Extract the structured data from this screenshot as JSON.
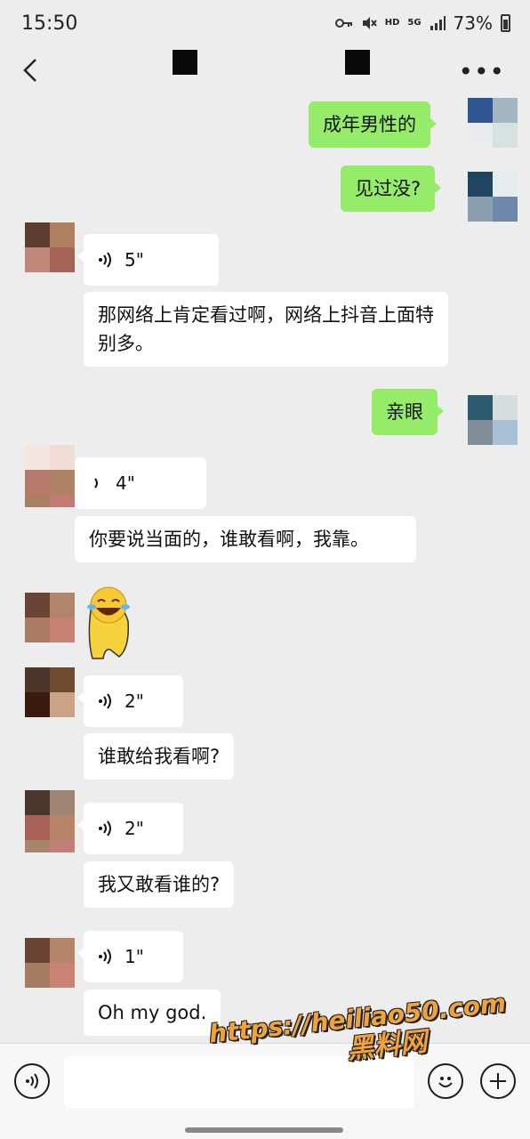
{
  "status_bar": {
    "time": "15:50",
    "hd_label": "HD",
    "network_label": "5G",
    "battery_percent": "73%"
  },
  "header": {
    "back_icon": "chevron-left-icon",
    "more_icon": "more-dots-icon",
    "more_label": "•••"
  },
  "messages": [
    {
      "side": "out",
      "type": "text",
      "text": "成年男性的"
    },
    {
      "side": "out",
      "type": "text",
      "text": "见过没?"
    },
    {
      "side": "in",
      "type": "voice",
      "duration": "5\""
    },
    {
      "side": "in",
      "type": "text",
      "text": "那网络上肯定看过啊，网络上抖音上面特别多。"
    },
    {
      "side": "out",
      "type": "text",
      "text": "亲眼"
    },
    {
      "side": "in",
      "type": "voice",
      "duration": "4\""
    },
    {
      "side": "in",
      "type": "text",
      "text": "你要说当面的，谁敢看啊，我靠。"
    },
    {
      "side": "in",
      "type": "sticker",
      "icon": "laughing-emoji-sticker"
    },
    {
      "side": "in",
      "type": "voice",
      "duration": "2\""
    },
    {
      "side": "in",
      "type": "text",
      "text": "谁敢给我看啊?"
    },
    {
      "side": "in",
      "type": "voice",
      "duration": "2\""
    },
    {
      "side": "in",
      "type": "text",
      "text": "我又敢看谁的?"
    },
    {
      "side": "in",
      "type": "voice",
      "duration": "1\""
    },
    {
      "side": "in",
      "type": "text",
      "text": "Oh my god."
    }
  ],
  "input_bar": {
    "voice_toggle_icon": "voice-wave-icon",
    "emoji_icon": "smiley-icon",
    "plus_icon": "plus-icon"
  },
  "watermark": {
    "url": "https://heiliao50.com",
    "name": "黑料网"
  },
  "colors": {
    "background": "#ededed",
    "outgoing_bubble": "#95ec69",
    "incoming_bubble": "#ffffff",
    "watermark": "#f2a23a"
  }
}
